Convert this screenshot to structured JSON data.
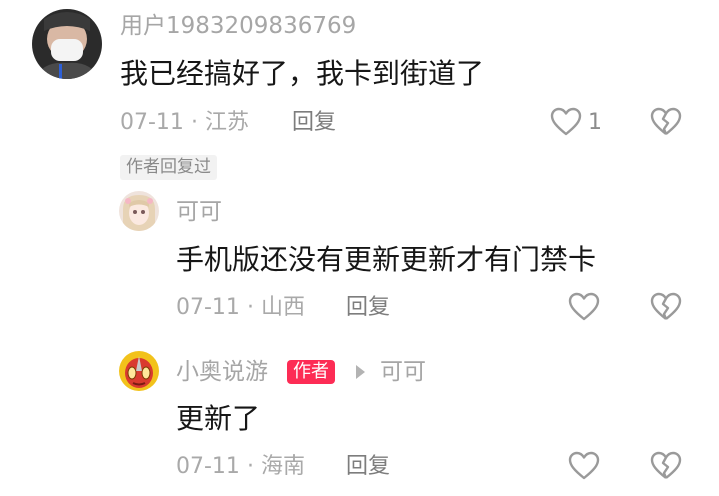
{
  "comment": {
    "username": "用户1983209836769",
    "text": "我已经搞好了，我卡到街道了",
    "date": "07-11",
    "location": "江苏",
    "reply_label": "回复",
    "like_count": "1",
    "author_replied_tag": "作者回复过",
    "avatar_icon": "person-mask-avatar-icon"
  },
  "replies": [
    {
      "username": "可可",
      "text": "手机版还没有更新更新才有门禁卡",
      "date": "07-11",
      "location": "山西",
      "reply_label": "回复",
      "avatar_icon": "anime-girl-avatar-icon"
    },
    {
      "username": "小奥说游",
      "author_badge": "作者",
      "reply_to": "可可",
      "text": "更新了",
      "date": "07-11",
      "location": "海南",
      "reply_label": "回复",
      "avatar_icon": "ultraman-avatar-icon"
    }
  ],
  "colors": {
    "author_badge": "#fd2c55",
    "text": "#161616",
    "muted": "#a6a6a6"
  }
}
